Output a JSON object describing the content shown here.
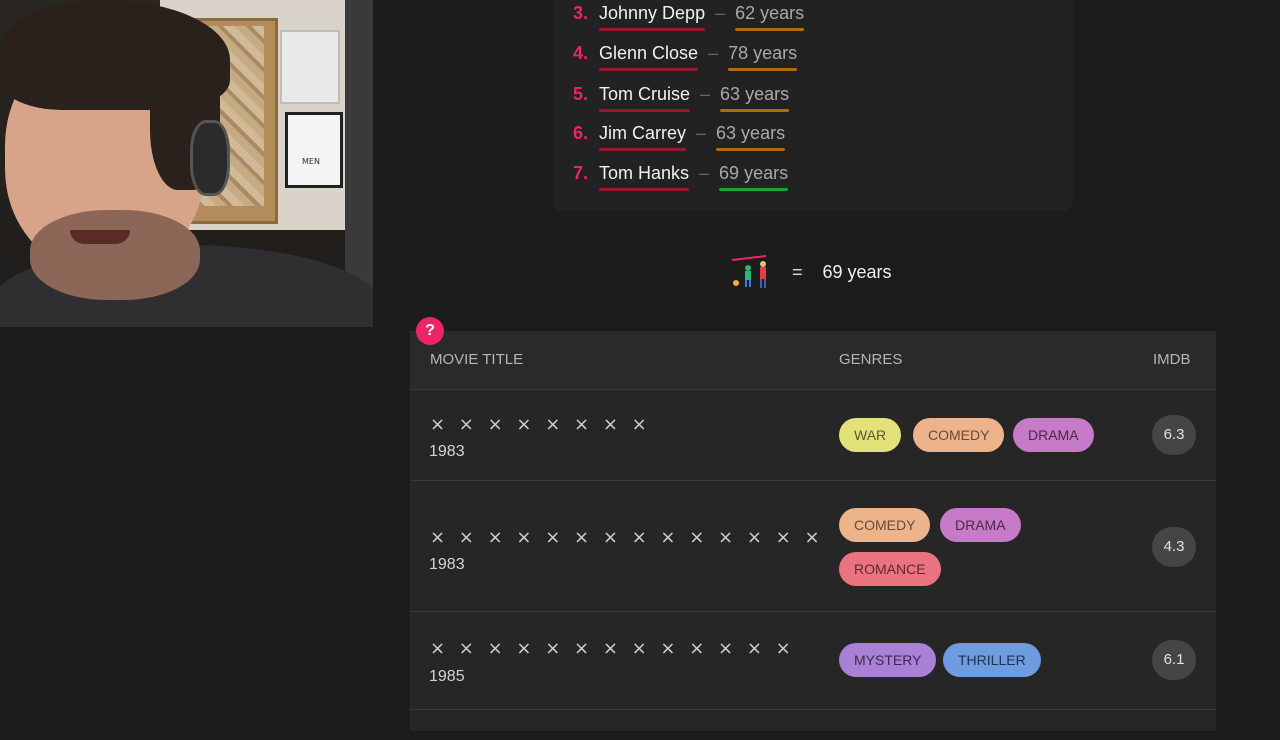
{
  "ranking": [
    {
      "rank": "3.",
      "name": "Johnny Depp",
      "age": "62 years",
      "match": false
    },
    {
      "rank": "4.",
      "name": "Glenn Close",
      "age": "78 years",
      "match": false
    },
    {
      "rank": "5.",
      "name": "Tom Cruise",
      "age": "63 years",
      "match": false
    },
    {
      "rank": "6.",
      "name": "Jim Carrey",
      "age": "63 years",
      "match": false
    },
    {
      "rank": "7.",
      "name": "Tom Hanks",
      "age": "69 years",
      "match": true
    }
  ],
  "result": {
    "equals": "=",
    "value": "69 years"
  },
  "table": {
    "help": "?",
    "headers": {
      "title": "MOVIE TITLE",
      "genres": "GENRES",
      "imdb": "IMDB"
    },
    "rows": [
      {
        "title": "× × × × × × × ×",
        "year": "1983",
        "genres": [
          "WAR",
          "COMEDY",
          "DRAMA"
        ],
        "imdb": "6.3"
      },
      {
        "title": "× × × × × ×  × ×  × × × × × ×",
        "year": "1983",
        "genres": [
          "COMEDY",
          "DRAMA",
          "ROMANCE"
        ],
        "imdb": "4.3"
      },
      {
        "title": "× × ×  × × × ×  × × × × × ×",
        "year": "1985",
        "genres": [
          "MYSTERY",
          "THRILLER"
        ],
        "imdb": "6.1"
      }
    ]
  },
  "colors": {
    "accent": "#ec2567",
    "name_underline": "#8f1b2d",
    "age_underline": "#b06a12",
    "match_underline": "#1f9e3a"
  },
  "icons": {
    "result": "family-icon"
  }
}
